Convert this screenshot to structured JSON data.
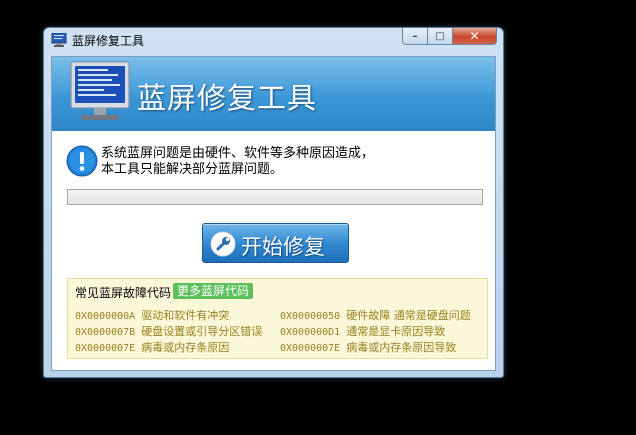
{
  "window": {
    "title": "蓝屏修复工具",
    "controls": {
      "minimize": "–",
      "maximize": "□",
      "close": "✕"
    }
  },
  "banner": {
    "title": "蓝屏修复工具"
  },
  "message": {
    "line1": "系统蓝屏问题是由硬件、软件等多种原因造成，",
    "line2": "本工具只能解决部分蓝屏问题。"
  },
  "progress": {
    "value": 0
  },
  "start_button": {
    "label": "开始修复"
  },
  "codes": {
    "header": "常见蓝屏故障代码",
    "more_button": "更多蓝屏代码",
    "items": [
      {
        "code": "0X0000000A",
        "desc": "驱动和软件有冲突"
      },
      {
        "code": "0X00000050",
        "desc": "硬件故障 通常是硬盘问题"
      },
      {
        "code": "0X0000007B",
        "desc": "硬盘设置或引导分区错误"
      },
      {
        "code": "0X000000D1",
        "desc": "通常是显卡原因导致"
      },
      {
        "code": "0X0000007E",
        "desc": "病毒或内存条原因"
      },
      {
        "code": "0X0000007E",
        "desc": "病毒或内存条原因导致"
      }
    ]
  },
  "colors": {
    "banner": "#3c97d6",
    "code_text": "#9a7f1f",
    "more_button": "#5cbf5c"
  }
}
